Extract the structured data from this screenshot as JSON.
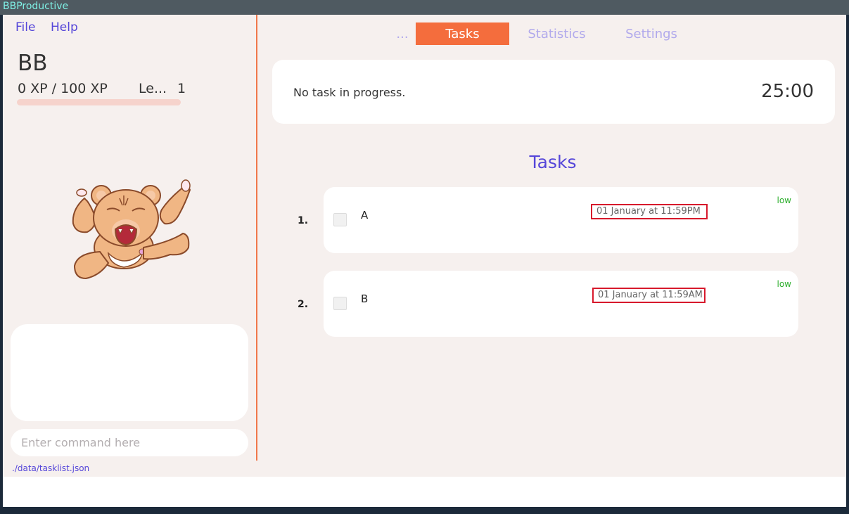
{
  "window": {
    "title": "BBProductive"
  },
  "menu": {
    "file": "File",
    "help": "Help"
  },
  "profile": {
    "name": "BB",
    "xp": "0 XP / 100 XP",
    "level_label": "Le...",
    "level_value": "1",
    "xp_progress": 0
  },
  "mascot": {
    "icon": "crying-bear-icon"
  },
  "command": {
    "placeholder": "Enter command here",
    "value": ""
  },
  "status": {
    "file_path": "./data/tasklist.json"
  },
  "tabs": [
    {
      "label": "...",
      "active": false
    },
    {
      "label": "Tasks",
      "active": true
    },
    {
      "label": "Statistics",
      "active": false
    },
    {
      "label": "Settings",
      "active": false
    }
  ],
  "timer": {
    "message": "No task in progress.",
    "time": "25:00"
  },
  "tasks": {
    "heading": "Tasks",
    "items": [
      {
        "index": "1.",
        "name": "A",
        "deadline": "01 January at 11:59PM",
        "priority": "low",
        "done": false
      },
      {
        "index": "2.",
        "name": "B",
        "deadline": "01 January at 11:59AM",
        "priority": "low",
        "done": false
      }
    ]
  },
  "colors": {
    "accent": "#f46d3d",
    "link": "#5546d9",
    "inactive_tab": "#b1a9ec",
    "priority_low": "#2cae2c",
    "deadline_border": "#d7192c",
    "background": "#f6f0ee"
  }
}
